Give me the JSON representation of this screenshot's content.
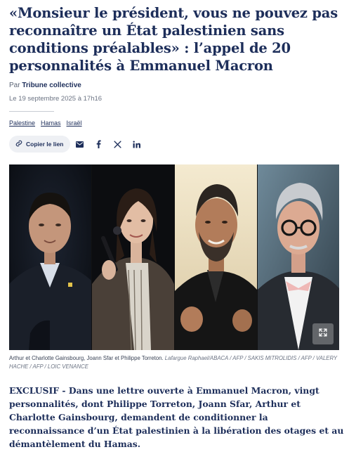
{
  "article": {
    "title": "«Monsieur le président, vous ne pouvez pas reconnaître un État palestinien sans conditions préalables» : l’appel de 20 personnalités à Emmanuel Macron",
    "byline_prefix": "Par",
    "author": "Tribune collective",
    "date": "Le 19 septembre 2025 à 17h16",
    "tags": [
      "Palestine",
      "Hamas",
      "Israël"
    ],
    "share": {
      "copy_label": "Copier le lien",
      "icons": [
        "link-icon",
        "email-icon",
        "facebook-icon",
        "x-icon",
        "linkedin-icon"
      ]
    },
    "image": {
      "caption": "Arthur et Charlotte Gainsbourg, Joann Sfar et Philippe Torreton.",
      "credit": "Lafargue Raphael/ABACA / AFP / SAKIS MITROLIDIS / AFP / VALERY HACHE / AFP / LOIC VENANCE",
      "expand_icon": "expand-icon"
    },
    "lead_label": "EXCLUSIF -",
    "lead_text": "Dans une lettre ouverte à Emmanuel Macron, vingt personnalités, dont Philippe Torreton, Joann Sfar, Arthur et Charlotte Gainsbourg, demandent de conditionner la reconnaissance d’un État palestinien à la libération des otages et au démantèlement du Hamas."
  },
  "colors": {
    "navy": "#1d2e5a",
    "muted": "#6b7383",
    "pill_bg": "#eef0f4"
  }
}
